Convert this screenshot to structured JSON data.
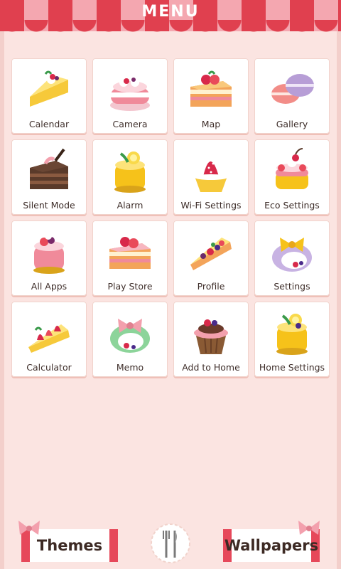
{
  "header": {
    "title": "MENU"
  },
  "tiles": [
    {
      "label": "Calendar",
      "icon": "tart-slice-icon"
    },
    {
      "label": "Camera",
      "icon": "cream-cake-icon"
    },
    {
      "label": "Map",
      "icon": "layer-cake-icon"
    },
    {
      "label": "Gallery",
      "icon": "macaron-icon"
    },
    {
      "label": "Silent Mode",
      "icon": "chocolate-cake-icon"
    },
    {
      "label": "Alarm",
      "icon": "lemon-cake-icon"
    },
    {
      "label": "Wi-Fi Settings",
      "icon": "strawberry-tart-icon"
    },
    {
      "label": "Eco Settings",
      "icon": "cherry-cake-icon"
    },
    {
      "label": "All Apps",
      "icon": "berry-mousse-icon"
    },
    {
      "label": "Play Store",
      "icon": "strawberry-layer-cake-icon"
    },
    {
      "label": "Profile",
      "icon": "berry-tart-slice-icon"
    },
    {
      "label": "Settings",
      "icon": "bow-dessert-icon"
    },
    {
      "label": "Calculator",
      "icon": "strawberry-slice-icon"
    },
    {
      "label": "Memo",
      "icon": "bow-cake-icon"
    },
    {
      "label": "Add to Home",
      "icon": "cupcake-icon"
    },
    {
      "label": "Home Settings",
      "icon": "lemon-mousse-icon"
    }
  ],
  "footer": {
    "themes_label": "Themes",
    "wallpapers_label": "Wallpapers",
    "center_icon": "fork-knife-plate-icon"
  },
  "colors": {
    "accent": "#e0404f",
    "background": "#fbe4e1",
    "tile": "#ffffff"
  }
}
